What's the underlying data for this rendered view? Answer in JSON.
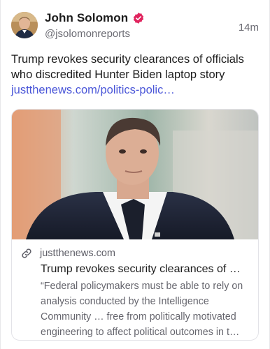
{
  "post": {
    "author_name": "John Solomon",
    "handle": "@jsolomonreports",
    "timestamp": "14m",
    "verified_icon": "verified-badge-icon",
    "text_lines": [
      "Trump revokes security clearances of officials",
      "who discredited Hunter Biden laptop story"
    ],
    "link_text": "justthenews.com/politics-polic…"
  },
  "card": {
    "domain": "justthenews.com",
    "title": "Trump revokes security clearances of …",
    "description_lines": [
      "“Federal policymakers must be able to rely on",
      "analysis conducted by the Intelligence",
      "Community … free from politically motivated",
      "engineering to affect political outcomes in t…"
    ],
    "link_icon": "link-icon"
  },
  "colors": {
    "link": "#4a56d8",
    "verified": "#e0245e",
    "secondary_text": "#6b6b73"
  }
}
